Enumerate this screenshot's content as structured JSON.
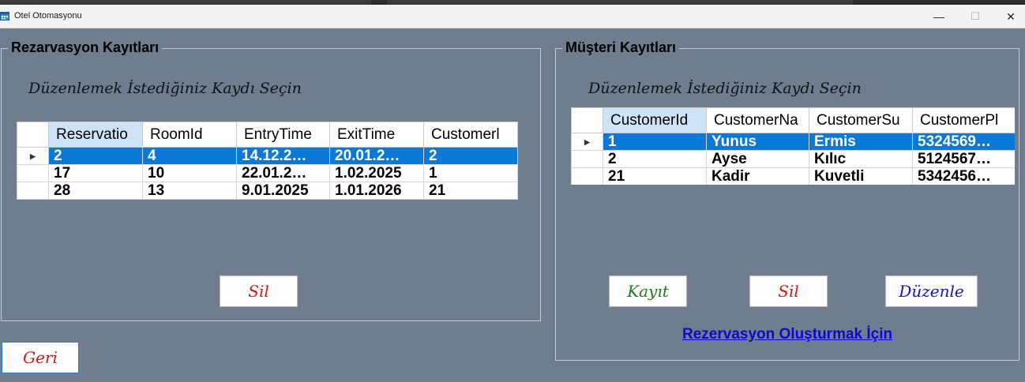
{
  "window": {
    "title": "Otel Otomasyonu",
    "minimize_glyph": "—",
    "maximize_glyph": "☐",
    "close_glyph": "✕"
  },
  "reservations": {
    "group_title": "Rezarvasyon Kayıtları",
    "hint": "Düzenlemek İstediğiniz Kaydı Seçin",
    "columns": [
      "Reservatio",
      "RoomId",
      "EntryTime",
      "ExitTime",
      "Customerl"
    ],
    "rows": [
      [
        "2",
        "4",
        "14.12.2…",
        "20.01.2…",
        "2"
      ],
      [
        "17",
        "10",
        "22.01.2…",
        "1.02.2025",
        "1"
      ],
      [
        "28",
        "13",
        "9.01.2025",
        "1.01.2026",
        "21"
      ]
    ],
    "selected_row": 0,
    "delete_label": "Sil"
  },
  "customers": {
    "group_title": "Müşteri Kayıtları",
    "hint": "Düzenlemek İstediğiniz Kaydı Seçin",
    "columns": [
      "CustomerId",
      "CustomerNa",
      "CustomerSu",
      "CustomerPl"
    ],
    "rows": [
      [
        "1",
        "Yunus",
        "Ermis",
        "5324569…"
      ],
      [
        "2",
        "Ayse",
        "Kılıc",
        "5124567…"
      ],
      [
        "21",
        "Kadir",
        "Kuvetli",
        "5342456…"
      ]
    ],
    "selected_row": 0,
    "save_label": "Kayıt",
    "delete_label": "Sil",
    "edit_label": "Düzenle",
    "link_label": "Rezervasyon Oluşturmak İçin"
  },
  "back_label": "Geri",
  "colors": {
    "background": "#6f7d8e",
    "selection": "#0a78d7",
    "green": "#1a7f1a",
    "red": "#d01818",
    "blue": "#1414c8",
    "link": "#0a0acc"
  }
}
